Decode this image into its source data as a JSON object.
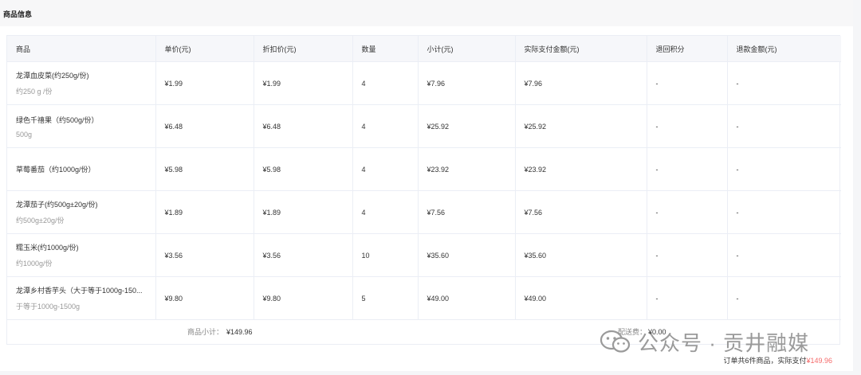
{
  "section": {
    "title": "商品信息"
  },
  "table": {
    "headers": [
      "商品",
      "单价(元)",
      "折扣价(元)",
      "数量",
      "小计(元)",
      "实际支付金额(元)",
      "退回积分",
      "退款金额(元)"
    ],
    "rows": [
      {
        "name": "龙潭血皮菜(约250g/份)",
        "spec": "约250 g /份",
        "unit_price": "¥1.99",
        "discount_price": "¥1.99",
        "qty": "4",
        "subtotal": "¥7.96",
        "paid": "¥7.96",
        "points": "-",
        "refund": "-"
      },
      {
        "name": "绿色千禧果（约500g/份）",
        "spec": "500g",
        "unit_price": "¥6.48",
        "discount_price": "¥6.48",
        "qty": "4",
        "subtotal": "¥25.92",
        "paid": "¥25.92",
        "points": "-",
        "refund": "-"
      },
      {
        "name": "草莓番茄（约1000g/份）",
        "spec": "",
        "unit_price": "¥5.98",
        "discount_price": "¥5.98",
        "qty": "4",
        "subtotal": "¥23.92",
        "paid": "¥23.92",
        "points": "-",
        "refund": "-"
      },
      {
        "name": "龙潭茄子(约500g±20g/份)",
        "spec": "约500g±20g/份",
        "unit_price": "¥1.89",
        "discount_price": "¥1.89",
        "qty": "4",
        "subtotal": "¥7.56",
        "paid": "¥7.56",
        "points": "-",
        "refund": "-"
      },
      {
        "name": "糯玉米(约1000g/份)",
        "spec": "约1000g/份",
        "unit_price": "¥3.56",
        "discount_price": "¥3.56",
        "qty": "10",
        "subtotal": "¥35.60",
        "paid": "¥35.60",
        "points": "-",
        "refund": "-"
      },
      {
        "name": "龙潭乡村香芋头（大于等于1000g-150...",
        "spec": "于等于1000g-1500g",
        "unit_price": "¥9.80",
        "discount_price": "¥9.80",
        "qty": "5",
        "subtotal": "¥49.00",
        "paid": "¥49.00",
        "points": "-",
        "refund": "-"
      }
    ]
  },
  "footer": {
    "subtotal_label": "商品小计：",
    "subtotal_value": "¥149.96",
    "shipping_label": "配送费：",
    "shipping_value": "¥0.00"
  },
  "summary": {
    "text": "订单共6件商品，实际支付",
    "price": "¥149.96"
  },
  "watermark": {
    "text": "公众号 · 贡井融媒"
  },
  "colors": {
    "accent_price": "#f56c6c",
    "header_bg": "#f6f7fa",
    "border": "#ebeef5"
  }
}
